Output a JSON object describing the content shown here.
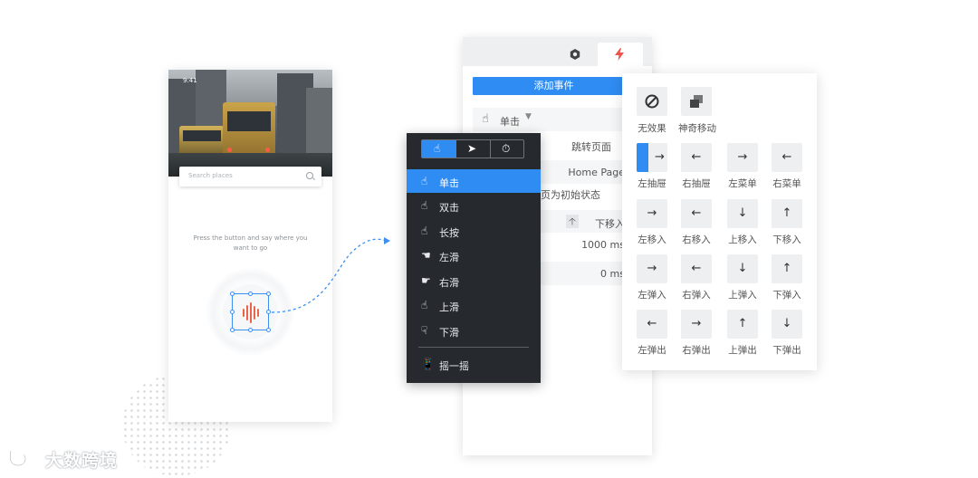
{
  "phone": {
    "status_time": "9:41",
    "search_placeholder": "Search places",
    "hint_line1": "Press the button and say where you",
    "hint_line2": "want to go"
  },
  "panel": {
    "tabs": [
      "settings-icon",
      "lightning-icon"
    ],
    "accent": "#2f8cf2",
    "add_event_label": "添加事件",
    "trigger_label": "单击",
    "action_label": "跳转页面",
    "target_page": "Home Page",
    "reset_label": "页为初始状态",
    "direction_label": "下移入",
    "duration": "1000 ms",
    "delay": "0 ms"
  },
  "event_menu": {
    "modes": [
      "hand-icon",
      "cursor-icon",
      "timer-icon"
    ],
    "items": [
      {
        "label": "单击",
        "icon": "tap-icon"
      },
      {
        "label": "双击",
        "icon": "double-tap-icon"
      },
      {
        "label": "长按",
        "icon": "long-press-icon"
      },
      {
        "label": "左滑",
        "icon": "swipe-left-icon"
      },
      {
        "label": "右滑",
        "icon": "swipe-right-icon"
      },
      {
        "label": "上滑",
        "icon": "swipe-up-icon"
      },
      {
        "label": "下滑",
        "icon": "swipe-down-icon"
      }
    ],
    "shake_label": "摇一摇",
    "selected": "单击"
  },
  "animations": {
    "row0": [
      {
        "label": "无效果",
        "icon": "none-icon"
      },
      {
        "label": "神奇移动",
        "icon": "magic-move-icon"
      }
    ],
    "grid": [
      [
        {
          "label": "左抽屉",
          "glyph": "→"
        },
        {
          "label": "右抽屉",
          "glyph": "←"
        },
        {
          "label": "左菜单",
          "glyph": "→"
        },
        {
          "label": "右菜单",
          "glyph": "←"
        }
      ],
      [
        {
          "label": "左移入",
          "glyph": "→"
        },
        {
          "label": "右移入",
          "glyph": "←"
        },
        {
          "label": "上移入",
          "glyph": "↓"
        },
        {
          "label": "下移入",
          "glyph": "↑"
        }
      ],
      [
        {
          "label": "左弹入",
          "glyph": "→"
        },
        {
          "label": "右弹入",
          "glyph": "←"
        },
        {
          "label": "上弹入",
          "glyph": "↓"
        },
        {
          "label": "下弹入",
          "glyph": "↑"
        }
      ],
      [
        {
          "label": "左弹出",
          "glyph": "←"
        },
        {
          "label": "右弹出",
          "glyph": "→"
        },
        {
          "label": "上弹出",
          "glyph": "↑"
        },
        {
          "label": "下弹出",
          "glyph": "↓"
        }
      ]
    ]
  },
  "watermark": "大数跨境"
}
